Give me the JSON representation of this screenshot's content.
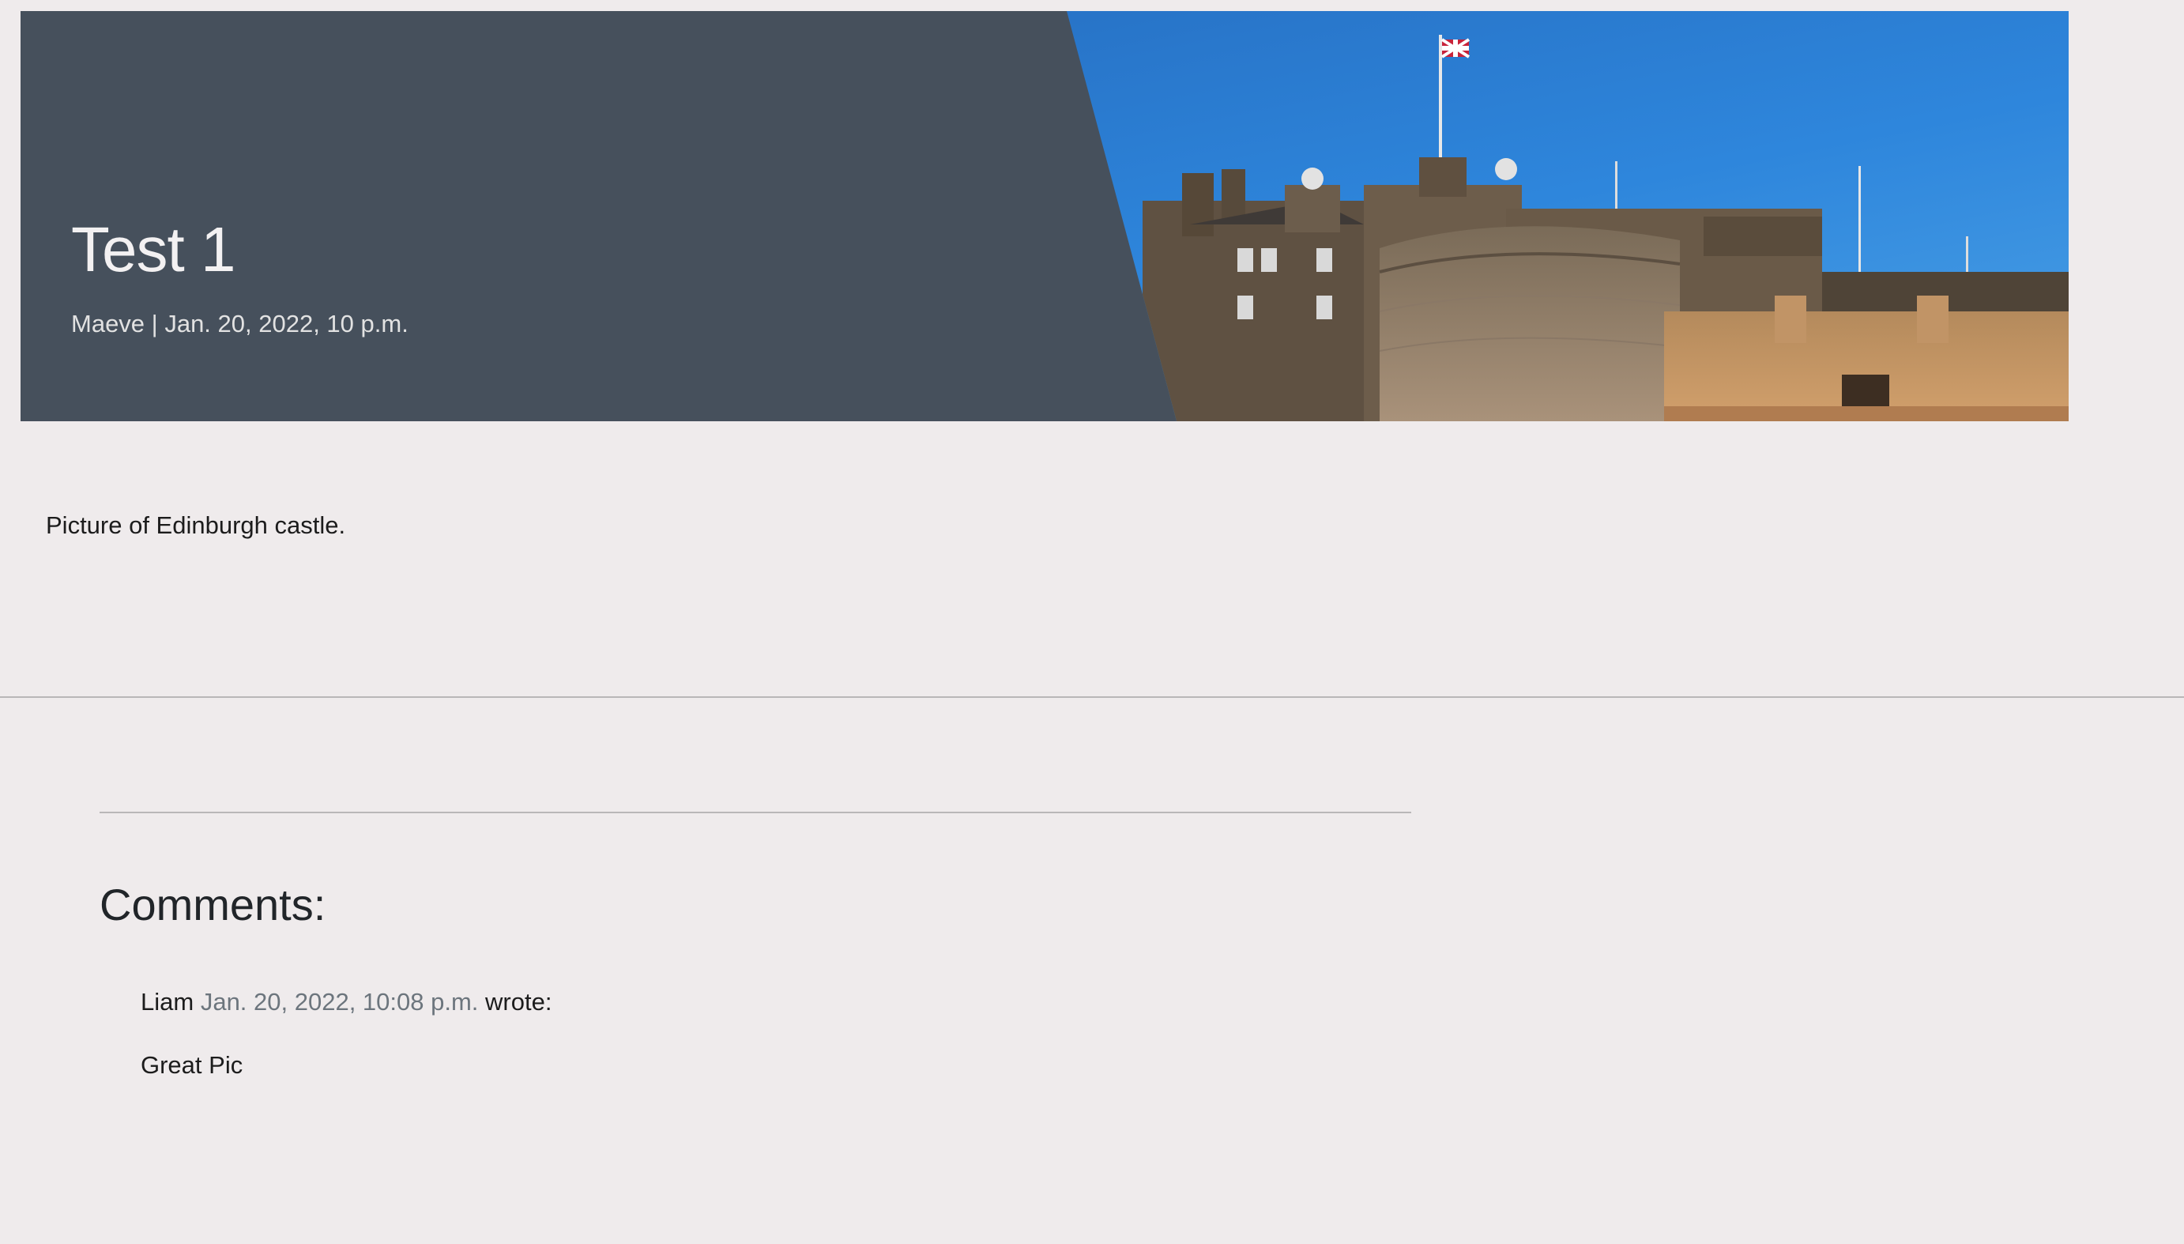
{
  "post": {
    "title": "Test 1",
    "meta": "Maeve | Jan. 20, 2022, 10 p.m.",
    "body": "Picture of Edinburgh castle.",
    "image_subject": "Edinburgh castle"
  },
  "comments": {
    "heading": "Comments:",
    "items": [
      {
        "author": "Liam",
        "date": "Jan. 20, 2022, 10:08 p.m.",
        "wrote": "wrote:",
        "text": "Great Pic"
      }
    ]
  }
}
